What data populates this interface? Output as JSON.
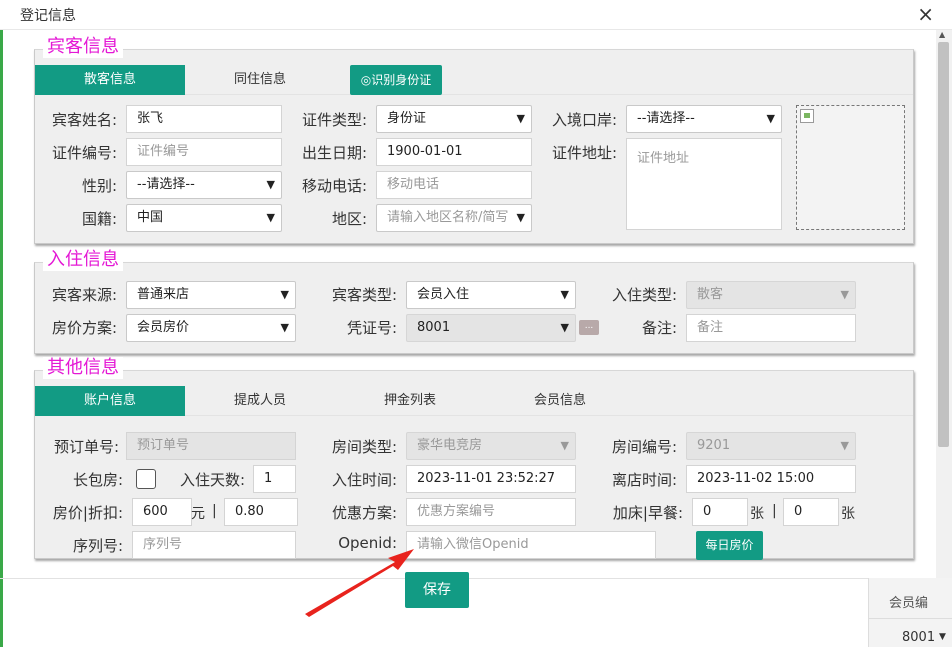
{
  "window": {
    "title": "登记信息",
    "close": "×"
  },
  "guest": {
    "legend": "宾客信息",
    "tabs": [
      "散客信息",
      "同住信息"
    ],
    "id_button": "◎识别身份证",
    "name_label": "宾客姓名:",
    "name_value": "张飞",
    "idtype_label": "证件类型:",
    "idtype_value": "身份证",
    "port_label": "入境口岸:",
    "port_value": "--请选择--",
    "idno_label": "证件编号:",
    "idno_placeholder": "证件编号",
    "birth_label": "出生日期:",
    "birth_value": "1900-01-01",
    "addr_label": "证件地址:",
    "addr_placeholder": "证件地址",
    "gender_label": "性别:",
    "gender_value": "--请选择--",
    "mobile_label": "移动电话:",
    "mobile_placeholder": "移动电话",
    "nation_label": "国籍:",
    "nation_value": "中国",
    "region_label": "地区:",
    "region_placeholder": "请输入地区名称/简写"
  },
  "checkin": {
    "legend": "入住信息",
    "source_label": "宾客来源:",
    "source_value": "普通来店",
    "gtype_label": "宾客类型:",
    "gtype_value": "会员入住",
    "ctype_label": "入住类型:",
    "ctype_value": "散客",
    "plan_label": "房价方案:",
    "plan_value": "会员房价",
    "voucher_label": "凭证号:",
    "voucher_value": "8001",
    "voucher_more": "...",
    "remark_label": "备注:",
    "remark_placeholder": "备注"
  },
  "other": {
    "legend": "其他信息",
    "tabs": [
      "账户信息",
      "提成人员",
      "押金列表",
      "会员信息"
    ],
    "order_label": "预订单号:",
    "order_placeholder": "预订单号",
    "roomtype_label": "房间类型:",
    "roomtype_value": "豪华电竞房",
    "roomno_label": "房间编号:",
    "roomno_value": "9201",
    "longstay_label": "长包房:",
    "days_label": "入住天数:",
    "days_value": "1",
    "in_label": "入住时间:",
    "in_value": "2023-11-01 23:52:27",
    "out_label": "离店时间:",
    "out_value": "2023-11-02 15:00",
    "price_label": "房价|折扣:",
    "price_value": "600",
    "price_unit": "元",
    "bar": "|",
    "discount_value": "0.80",
    "promo_label": "优惠方案:",
    "promo_placeholder": "优惠方案编号",
    "extra_label": "加床|早餐:",
    "bed_value": "0",
    "bed_unit": "张",
    "breakfast_value": "0",
    "breakfast_unit": "张",
    "serial_label": "序列号:",
    "serial_placeholder": "序列号",
    "openid_label": "Openid:",
    "openid_placeholder": "请输入微信Openid",
    "daily_button": "每日房价"
  },
  "footer": {
    "save": "保存",
    "member_label": "会员编",
    "member_value": "8001"
  },
  "colors": {
    "accent": "#129b84",
    "legend": "#e418d5",
    "edge": "#3aa848",
    "annotation": "#e8231d"
  }
}
